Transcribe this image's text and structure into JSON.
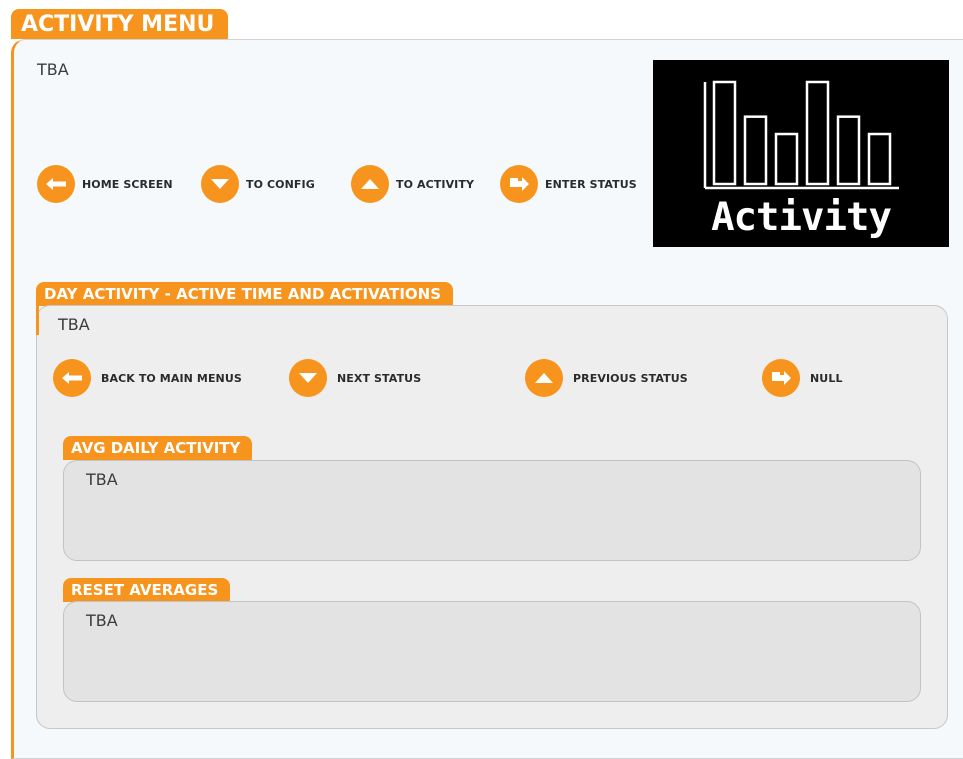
{
  "main": {
    "title": "ACTIVITY MENU",
    "description": "TBA",
    "buttons": [
      {
        "label": "HOME SCREEN",
        "icon": "left-arrow-icon"
      },
      {
        "label": "TO CONFIG",
        "icon": "down-arrow-icon"
      },
      {
        "label": "TO ACTIVITY",
        "icon": "up-arrow-icon"
      },
      {
        "label": "ENTER STATUS",
        "icon": "enter-arrow-icon"
      }
    ],
    "screen": {
      "label": "Activity",
      "bars": [
        1.0,
        0.66,
        0.49,
        1.0,
        0.66,
        0.49
      ],
      "icon": "bar-chart-icon"
    }
  },
  "day_activity": {
    "title": "DAY ACTIVITY - ACTIVE TIME AND ACTIVATIONS",
    "description": "TBA",
    "buttons": [
      {
        "label": "BACK TO MAIN MENUS",
        "icon": "left-arrow-icon"
      },
      {
        "label": "NEXT STATUS",
        "icon": "down-arrow-icon"
      },
      {
        "label": "PREVIOUS STATUS",
        "icon": "up-arrow-icon"
      },
      {
        "label": "NULL",
        "icon": "enter-arrow-icon"
      }
    ],
    "avg_daily": {
      "title": "AVG DAILY ACTIVITY",
      "description": "TBA"
    },
    "reset_averages": {
      "title": "RESET AVERAGES",
      "description": "TBA"
    }
  },
  "colors": {
    "accent": "#f7941d",
    "screen_bg": "#000000",
    "panel_bg": "#efeeee"
  }
}
